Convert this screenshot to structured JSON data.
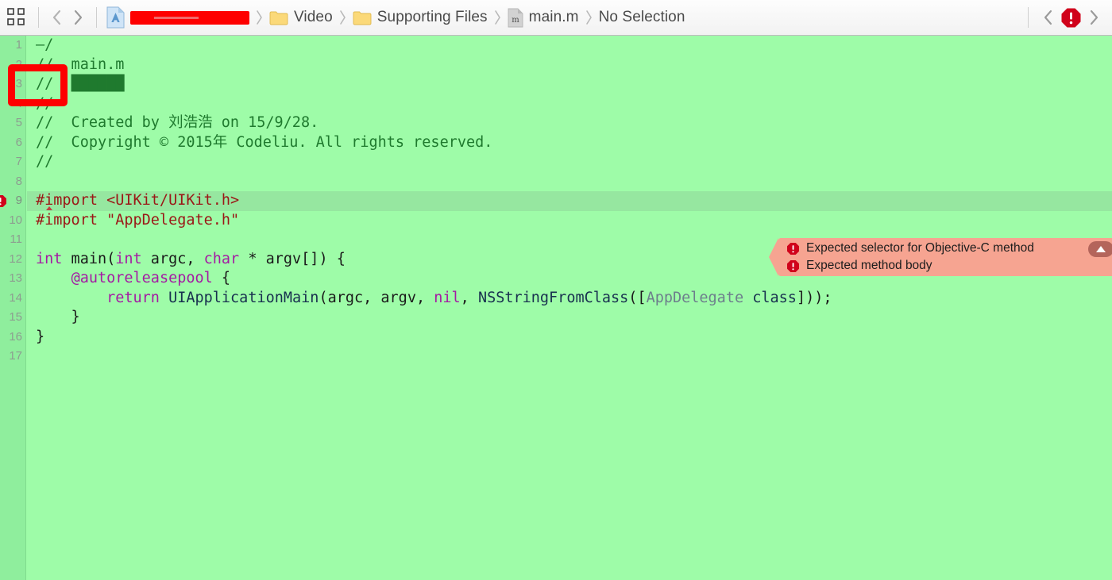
{
  "toolbar": {
    "layout_icon": "grid-layout-icon",
    "back_label": "‹",
    "forward_label": "›",
    "breadcrumb": [
      {
        "icon": "xcode-project-icon",
        "label": "",
        "redacted": true
      },
      {
        "icon": "folder-icon",
        "label": "Video",
        "redacted": false
      },
      {
        "icon": "folder-icon",
        "label": "Supporting Files",
        "redacted": false
      },
      {
        "icon": "objc-file-icon",
        "label": "main.m",
        "redacted": false
      },
      {
        "icon": "",
        "label": "No Selection",
        "redacted": false
      }
    ],
    "issue_prev_label": "‹",
    "issue_next_label": "›",
    "issue_badge": "error-octagon-icon"
  },
  "editor": {
    "background_color": "#9efca8",
    "gutter_color": "#8fee9d",
    "error_line_number": 9,
    "lines": [
      {
        "n": 1,
        "tokens": [
          {
            "t": "–/",
            "c": "c-comment"
          }
        ],
        "error": false
      },
      {
        "n": 2,
        "tokens": [
          {
            "t": "//  main.m",
            "c": "c-comment"
          }
        ],
        "error": false
      },
      {
        "n": 3,
        "tokens": [
          {
            "t": "//  ",
            "c": "c-comment"
          },
          {
            "t": "██████",
            "c": "c-comment"
          }
        ],
        "error": false
      },
      {
        "n": 4,
        "tokens": [
          {
            "t": "//",
            "c": "c-comment"
          }
        ],
        "error": false
      },
      {
        "n": 5,
        "tokens": [
          {
            "t": "//  Created by 刘浩浩 on 15/9/28.",
            "c": "c-comment"
          }
        ],
        "error": false
      },
      {
        "n": 6,
        "tokens": [
          {
            "t": "//  Copyright © 2015年 Codeliu. All rights reserved.",
            "c": "c-comment"
          }
        ],
        "error": false
      },
      {
        "n": 7,
        "tokens": [
          {
            "t": "//",
            "c": "c-comment"
          }
        ],
        "error": false
      },
      {
        "n": 8,
        "tokens": [],
        "error": false
      },
      {
        "n": 9,
        "tokens": [
          {
            "t": "#import ",
            "c": "c-pre"
          },
          {
            "t": "<UIKit/UIKit.h>",
            "c": "c-str"
          }
        ],
        "error": true
      },
      {
        "n": 10,
        "tokens": [
          {
            "t": "#import ",
            "c": "c-pre"
          },
          {
            "t": "\"AppDelegate.h\"",
            "c": "c-str"
          }
        ],
        "error": false
      },
      {
        "n": 11,
        "tokens": [],
        "error": false
      },
      {
        "n": 12,
        "tokens": [
          {
            "t": "int",
            "c": "c-kw"
          },
          {
            "t": " main(",
            "c": "c-plain"
          },
          {
            "t": "int",
            "c": "c-kw"
          },
          {
            "t": " argc, ",
            "c": "c-plain"
          },
          {
            "t": "char",
            "c": "c-kw"
          },
          {
            "t": " * argv[]) {",
            "c": "c-plain"
          }
        ],
        "error": false
      },
      {
        "n": 13,
        "tokens": [
          {
            "t": "    ",
            "c": "c-plain"
          },
          {
            "t": "@autoreleasepool",
            "c": "c-kw"
          },
          {
            "t": " {",
            "c": "c-plain"
          }
        ],
        "error": false
      },
      {
        "n": 14,
        "tokens": [
          {
            "t": "        ",
            "c": "c-plain"
          },
          {
            "t": "return",
            "c": "c-kw"
          },
          {
            "t": " ",
            "c": "c-plain"
          },
          {
            "t": "UIApplicationMain",
            "c": "c-func"
          },
          {
            "t": "(argc, argv, ",
            "c": "c-plain"
          },
          {
            "t": "nil",
            "c": "c-kw"
          },
          {
            "t": ", ",
            "c": "c-plain"
          },
          {
            "t": "NSStringFromClass",
            "c": "c-func"
          },
          {
            "t": "([",
            "c": "c-plain"
          },
          {
            "t": "AppDelegate",
            "c": "c-type"
          },
          {
            "t": " ",
            "c": "c-plain"
          },
          {
            "t": "class",
            "c": "c-cls"
          },
          {
            "t": "]));",
            "c": "c-plain"
          }
        ],
        "error": false
      },
      {
        "n": 15,
        "tokens": [
          {
            "t": "    }",
            "c": "c-plain"
          }
        ],
        "error": false
      },
      {
        "n": 16,
        "tokens": [
          {
            "t": "}",
            "c": "c-plain"
          }
        ],
        "error": false
      },
      {
        "n": 17,
        "tokens": [],
        "error": false
      }
    ]
  },
  "error_banner": {
    "messages": [
      "Expected selector for Objective-C method",
      "Expected method body"
    ],
    "collapse_icon": "triangle-up-icon",
    "background_color": "#f6a491"
  },
  "annotation": {
    "shape": "rectangle",
    "color": "#fe0000",
    "targets_line": 1
  }
}
